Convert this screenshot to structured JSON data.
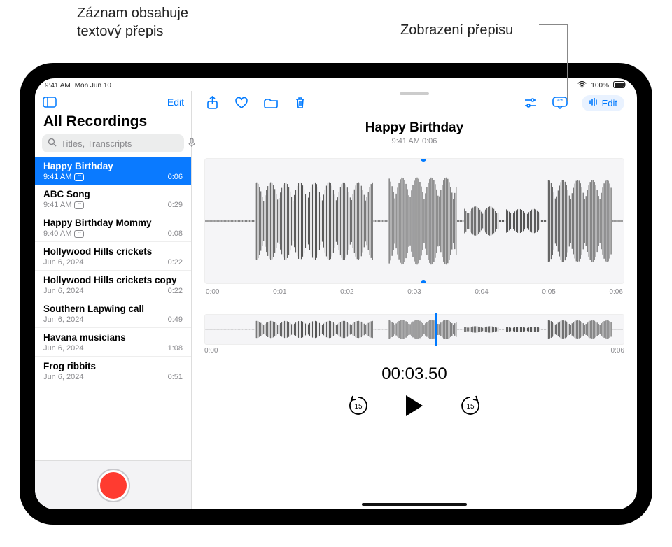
{
  "callouts": {
    "left": "Záznam obsahuje\ntextový přepis",
    "right": "Zobrazení přepisu"
  },
  "statusbar": {
    "time": "9:41 AM",
    "date": "Mon Jun 10",
    "battery": "100%"
  },
  "sidebar": {
    "edit": "Edit",
    "heading": "All Recordings",
    "search_placeholder": "Titles, Transcripts"
  },
  "recordings": [
    {
      "title": "Happy Birthday",
      "sub": "9:41 AM",
      "dur": "0:06",
      "transcript": true,
      "selected": true
    },
    {
      "title": "ABC Song",
      "sub": "9:41 AM",
      "dur": "0:29",
      "transcript": true,
      "selected": false
    },
    {
      "title": "Happy Birthday Mommy",
      "sub": "9:40 AM",
      "dur": "0:08",
      "transcript": true,
      "selected": false
    },
    {
      "title": "Hollywood Hills crickets",
      "sub": "Jun 6, 2024",
      "dur": "0:22",
      "transcript": false,
      "selected": false
    },
    {
      "title": "Hollywood Hills crickets copy",
      "sub": "Jun 6, 2024",
      "dur": "0:22",
      "transcript": false,
      "selected": false
    },
    {
      "title": "Southern Lapwing call",
      "sub": "Jun 6, 2024",
      "dur": "0:49",
      "transcript": false,
      "selected": false
    },
    {
      "title": "Havana musicians",
      "sub": "Jun 6, 2024",
      "dur": "1:08",
      "transcript": false,
      "selected": false
    },
    {
      "title": "Frog ribbits",
      "sub": "Jun 6, 2024",
      "dur": "0:51",
      "transcript": false,
      "selected": false
    }
  ],
  "detail": {
    "title": "Happy Birthday",
    "subtitle": "9:41 AM   0:06",
    "timeline": [
      "0:00",
      "0:01",
      "0:02",
      "0:03",
      "0:04",
      "0:05",
      "0:06"
    ],
    "mini_start": "0:00",
    "mini_end": "0:06",
    "current_time": "00:03.50",
    "edit_chip": "Edit",
    "skip_seconds": "15"
  }
}
